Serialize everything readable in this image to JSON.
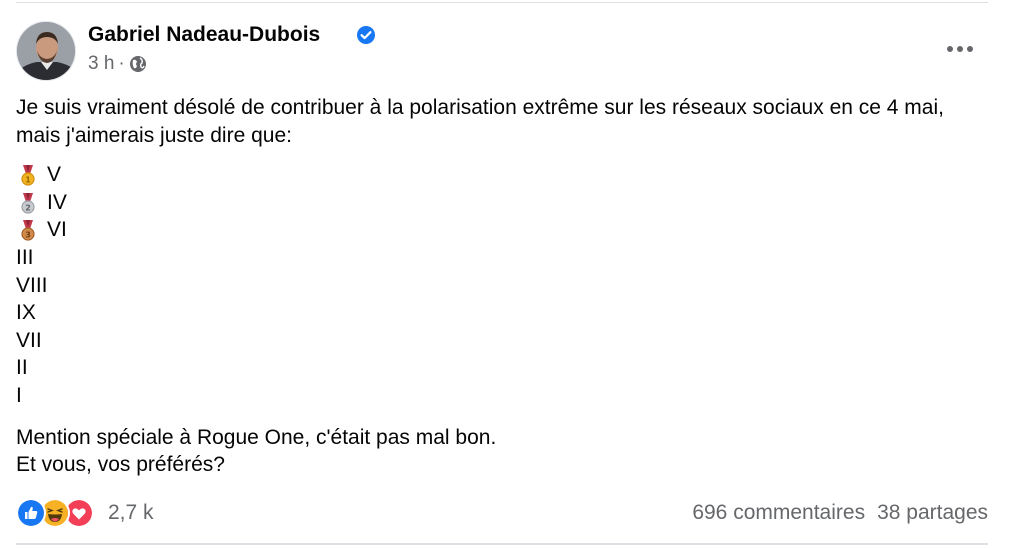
{
  "post": {
    "author": "Gabriel Nadeau-Dubois",
    "time": "3 h",
    "separator": "·",
    "intro": "Je suis vraiment désolé de contribuer à la polarisation extrême sur les réseaux sociaux en ce 4 mai, mais j'aimerais juste dire que:",
    "rankings": [
      {
        "medal": "gold-medal-icon",
        "label": "V"
      },
      {
        "medal": "silver-medal-icon",
        "label": "IV"
      },
      {
        "medal": "bronze-medal-icon",
        "label": "VI"
      },
      {
        "medal": "",
        "label": "III"
      },
      {
        "medal": "",
        "label": "VIII"
      },
      {
        "medal": "",
        "label": "IX"
      },
      {
        "medal": "",
        "label": "VII"
      },
      {
        "medal": "",
        "label": "II"
      },
      {
        "medal": "",
        "label": "I"
      }
    ],
    "outro_line1": "Mention spéciale à Rogue One, c'était pas mal bon.",
    "outro_line2": "Et vous, vos préférés?"
  },
  "footer": {
    "reaction_icons": [
      "like-icon",
      "haha-icon",
      "love-icon"
    ],
    "reaction_count": "2,7 k",
    "comments": "696 commentaires",
    "shares": "38 partages"
  },
  "colors": {
    "facebook_blue": "#1877f2",
    "secondary_text": "#65676b",
    "love_red": "#f33e58",
    "haha_yellow": "#f7b125",
    "divider": "#dcdfe4"
  }
}
